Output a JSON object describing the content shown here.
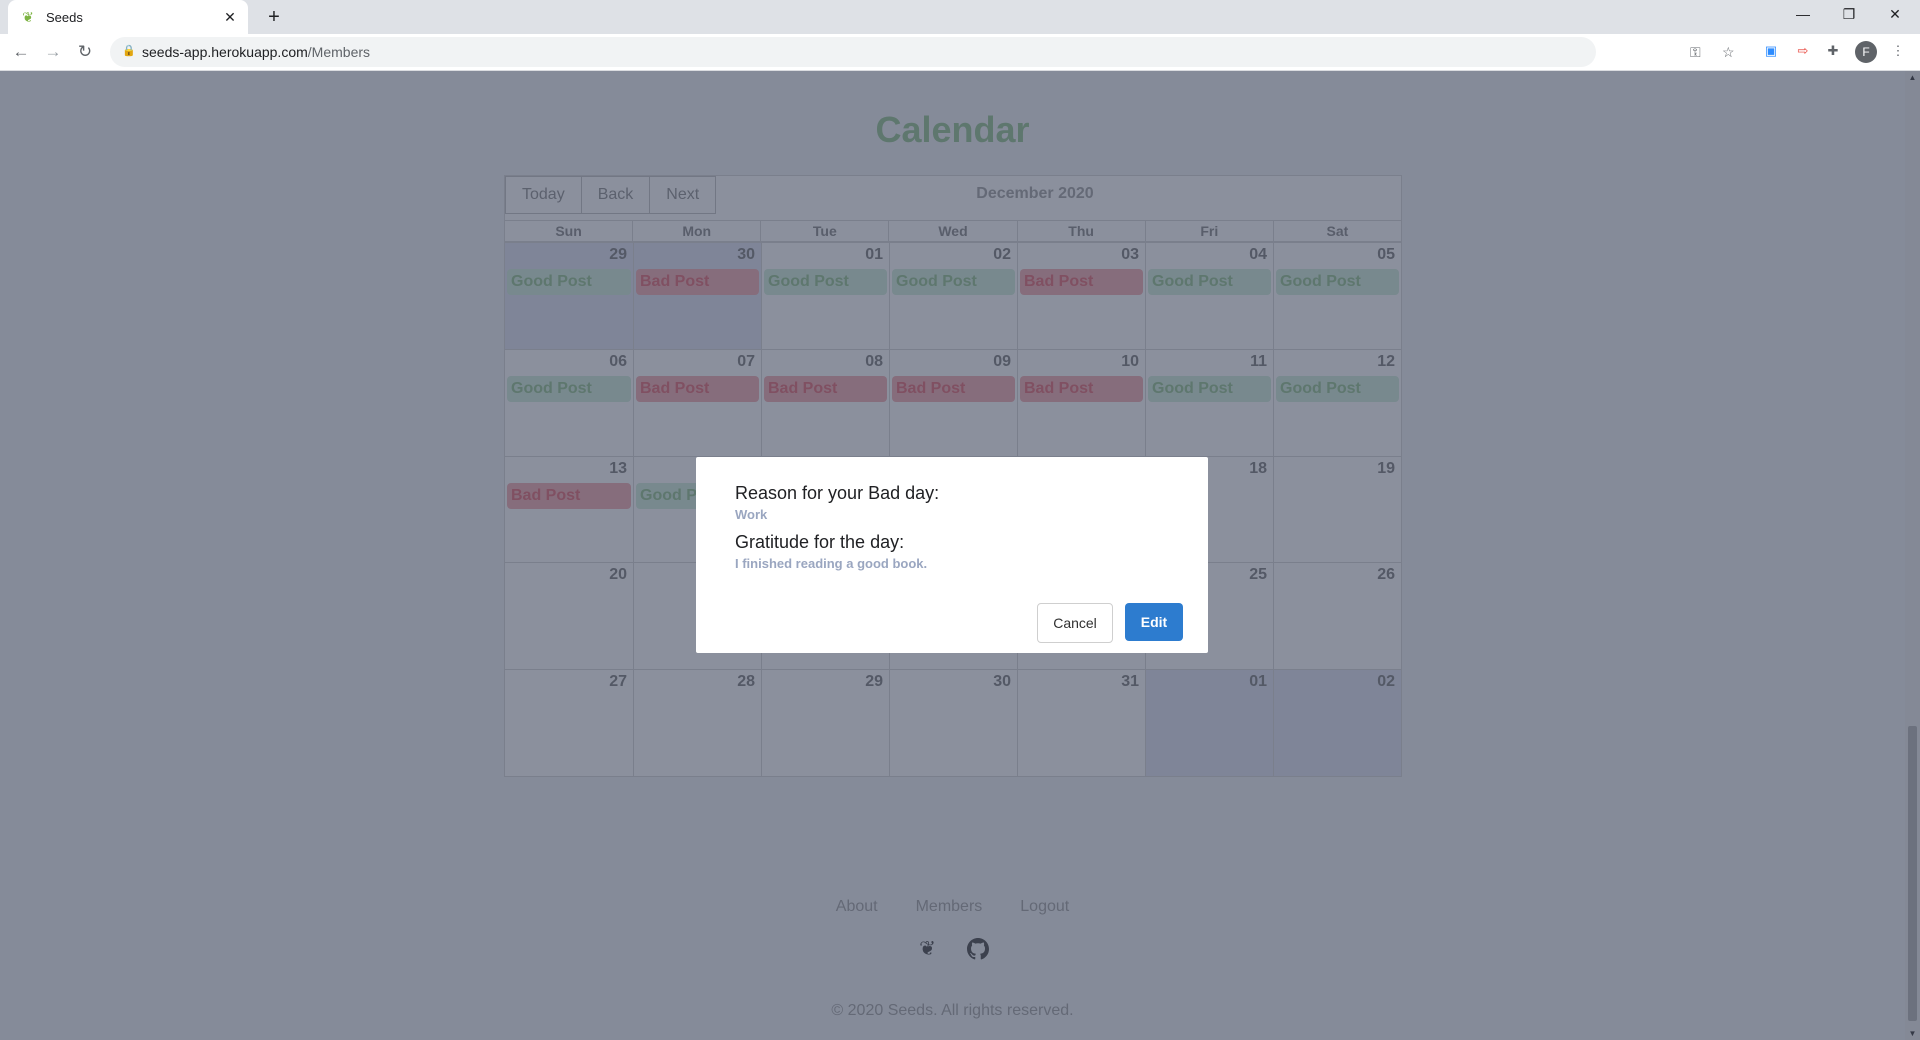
{
  "browser": {
    "tab_title": "Seeds",
    "url_host": "seeds-app.herokuapp.com",
    "url_path": "/Members"
  },
  "calendar": {
    "title": "Calendar",
    "buttons": [
      "Today",
      "Back",
      "Next"
    ],
    "month": "December 2020",
    "weekdays": [
      "Sun",
      "Mon",
      "Tue",
      "Wed",
      "Thu",
      "Fri",
      "Sat"
    ],
    "weeks": [
      [
        {
          "day": "29",
          "off": true,
          "event": "Good Post",
          "type": "good"
        },
        {
          "day": "30",
          "off": true,
          "event": "Bad Post",
          "type": "bad"
        },
        {
          "day": "01",
          "off": false,
          "event": "Good Post",
          "type": "good"
        },
        {
          "day": "02",
          "off": false,
          "event": "Good Post",
          "type": "good"
        },
        {
          "day": "03",
          "off": false,
          "event": "Bad Post",
          "type": "bad"
        },
        {
          "day": "04",
          "off": false,
          "event": "Good Post",
          "type": "good"
        },
        {
          "day": "05",
          "off": false,
          "event": "Good Post",
          "type": "good"
        }
      ],
      [
        {
          "day": "06",
          "off": false,
          "event": "Good Post",
          "type": "good"
        },
        {
          "day": "07",
          "off": false,
          "event": "Bad Post",
          "type": "bad"
        },
        {
          "day": "08",
          "off": false,
          "event": "Bad Post",
          "type": "bad"
        },
        {
          "day": "09",
          "off": false,
          "event": "Bad Post",
          "type": "bad"
        },
        {
          "day": "10",
          "off": false,
          "event": "Bad Post",
          "type": "bad"
        },
        {
          "day": "11",
          "off": false,
          "event": "Good Post",
          "type": "good"
        },
        {
          "day": "12",
          "off": false,
          "event": "Good Post",
          "type": "good"
        }
      ],
      [
        {
          "day": "13",
          "off": false,
          "event": "Bad Post",
          "type": "bad"
        },
        {
          "day": "",
          "off": false,
          "event": "Good Post",
          "type": "good"
        },
        {
          "day": "",
          "off": false,
          "event": "",
          "type": ""
        },
        {
          "day": "",
          "off": false,
          "event": "",
          "type": ""
        },
        {
          "day": "",
          "off": false,
          "event": "",
          "type": ""
        },
        {
          "day": "18",
          "off": false,
          "event": "",
          "type": ""
        },
        {
          "day": "19",
          "off": false,
          "event": "",
          "type": ""
        }
      ],
      [
        {
          "day": "20",
          "off": false,
          "event": "",
          "type": ""
        },
        {
          "day": "",
          "off": false,
          "event": "",
          "type": ""
        },
        {
          "day": "",
          "off": false,
          "event": "",
          "type": ""
        },
        {
          "day": "",
          "off": false,
          "event": "",
          "type": ""
        },
        {
          "day": "",
          "off": false,
          "event": "",
          "type": ""
        },
        {
          "day": "25",
          "off": false,
          "event": "",
          "type": ""
        },
        {
          "day": "26",
          "off": false,
          "event": "",
          "type": ""
        }
      ],
      [
        {
          "day": "27",
          "off": false,
          "event": "",
          "type": ""
        },
        {
          "day": "28",
          "off": false,
          "event": "",
          "type": ""
        },
        {
          "day": "29",
          "off": false,
          "event": "",
          "type": ""
        },
        {
          "day": "30",
          "off": false,
          "event": "",
          "type": ""
        },
        {
          "day": "31",
          "off": false,
          "event": "",
          "type": ""
        },
        {
          "day": "01",
          "off": true,
          "event": "",
          "type": ""
        },
        {
          "day": "02",
          "off": true,
          "event": "",
          "type": ""
        }
      ]
    ]
  },
  "modal": {
    "reason_label": "Reason for your Bad day:",
    "reason_value": "Work",
    "gratitude_label": "Gratitude for the day:",
    "gratitude_value": "I finished reading a good book.",
    "cancel_label": "Cancel",
    "edit_label": "Edit"
  },
  "footer": {
    "links": [
      "About",
      "Members",
      "Logout"
    ],
    "icons": [
      "seeds-logo-icon",
      "github-icon"
    ],
    "copyright": "© 2020 Seeds. All rights reserved."
  },
  "colors": {
    "good_bg": "#d8f0e0",
    "bad_bg": "#f5b9bd",
    "accent": "#2d7ccf",
    "title": "#a5cca0"
  }
}
